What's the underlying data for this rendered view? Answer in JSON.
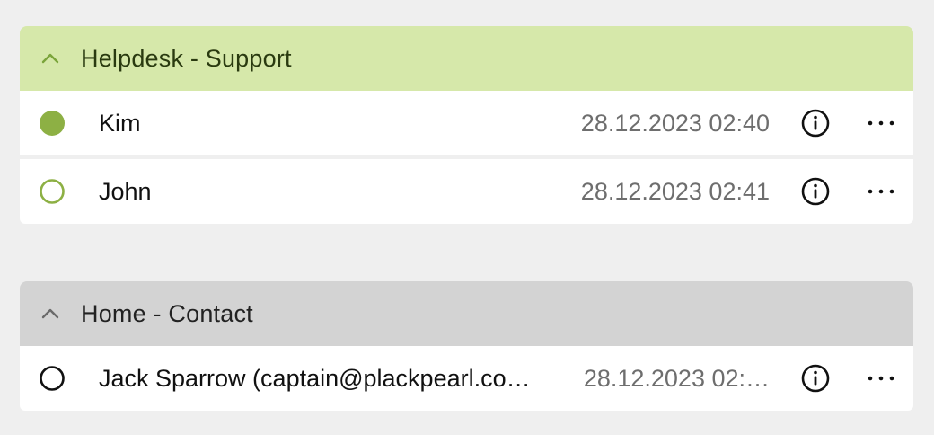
{
  "groups": [
    {
      "title": "Helpdesk - Support",
      "color": "#d6e8aa",
      "expanded": true,
      "items": [
        {
          "name": "Kim",
          "time": "28.12.2023 02:40",
          "status": "online"
        },
        {
          "name": "John",
          "time": "28.12.2023 02:41",
          "status": "offline"
        }
      ]
    },
    {
      "title": "Home - Contact",
      "color": "#d3d3d3",
      "expanded": true,
      "items": [
        {
          "name": "Jack Sparrow (captain@plackpearl.co…",
          "time": "28.12.2023 02:…",
          "status": "neutral"
        }
      ]
    }
  ],
  "icons": {
    "collapse": "chevron-up-icon",
    "info": "info-circle-icon",
    "more": "more-horizontal-icon"
  },
  "colors": {
    "online": "#8db044",
    "offline_ring": "#8db044",
    "neutral_ring": "#111111"
  }
}
